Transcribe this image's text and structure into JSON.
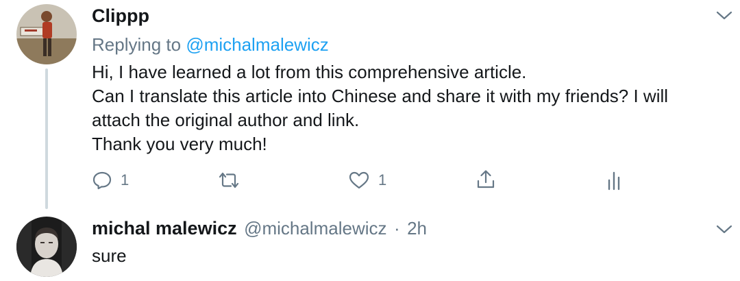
{
  "tweet1": {
    "display_name": "Clippp",
    "replying_prefix": "Replying to",
    "replying_handle": "@michalmalewicz",
    "lines": [
      "Hi, I have learned a lot from this comprehensive article.",
      "Can I translate this article into Chinese and share it with my friends? I will",
      "attach the original author and link.",
      "Thank you very much!"
    ],
    "actions": {
      "reply_count": "1",
      "retweet_count": "",
      "like_count": "1"
    }
  },
  "tweet2": {
    "display_name": "michal malewicz",
    "handle": "@michalmalewicz",
    "separator": "·",
    "time": "2h",
    "text": "sure"
  },
  "icons": [
    "reply-icon",
    "retweet-icon",
    "like-icon",
    "share-icon",
    "analytics-icon",
    "chevron-down-icon"
  ],
  "colors": {
    "muted": "#657786",
    "link": "#1da1f2",
    "thread_line": "#cfd9de"
  }
}
